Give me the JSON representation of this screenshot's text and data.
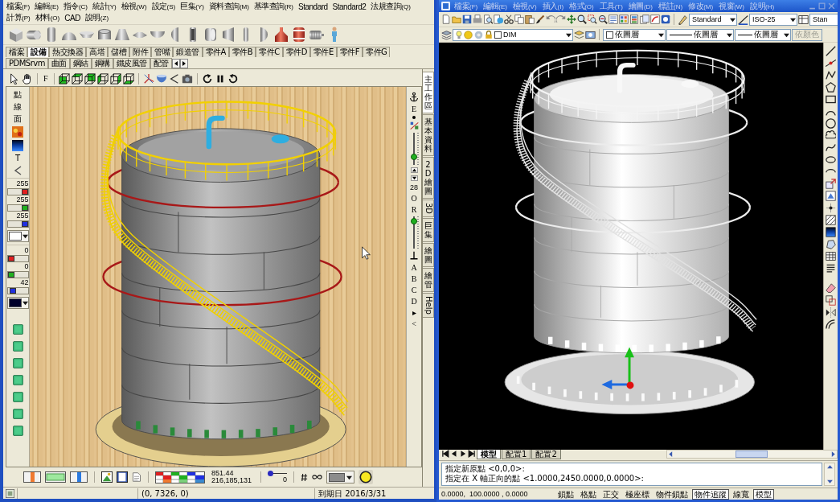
{
  "left_window": {
    "menu": [
      {
        "label": "檔案",
        "mnemonic": "(F)"
      },
      {
        "label": "編輯",
        "mnemonic": "(E)"
      },
      {
        "label": "指令",
        "mnemonic": "(C)"
      },
      {
        "label": "統計",
        "mnemonic": "(Y)"
      },
      {
        "label": "檢視",
        "mnemonic": "(W)"
      },
      {
        "label": "設定",
        "mnemonic": "(S)"
      },
      {
        "label": "巨集",
        "mnemonic": "(Y)"
      },
      {
        "label": "資料查詢",
        "mnemonic": "(M)"
      },
      {
        "label": "基準查詢",
        "mnemonic": "(R)"
      },
      {
        "label": "Standard"
      },
      {
        "label": "Standard2"
      },
      {
        "label": "法規查詢",
        "mnemonic": "(Q)"
      },
      {
        "label": "計算",
        "mnemonic": "(P)"
      },
      {
        "label": "材料",
        "mnemonic": "(O)"
      },
      {
        "label": "CAD"
      },
      {
        "label": "說明",
        "mnemonic": "(Z)"
      }
    ],
    "tabs": [
      {
        "label": "檔案",
        "selected": false
      },
      {
        "label": "設備",
        "selected": true
      },
      {
        "label": "熱交換器",
        "selected": false
      },
      {
        "label": "高塔",
        "selected": false
      },
      {
        "label": "儲槽",
        "selected": false
      },
      {
        "label": "附件",
        "selected": false
      },
      {
        "label": "管嘴",
        "selected": false
      },
      {
        "label": "鍛造管",
        "selected": false
      },
      {
        "label": "零件A",
        "selected": false
      },
      {
        "label": "零件B",
        "selected": false
      },
      {
        "label": "零件C",
        "selected": false
      },
      {
        "label": "零件D",
        "selected": false
      },
      {
        "label": "零件E",
        "selected": false
      },
      {
        "label": "零件F",
        "selected": false
      },
      {
        "label": "零件G",
        "selected": false
      },
      {
        "label": "PDMSrvm",
        "selected": false
      },
      {
        "label": "曲面",
        "selected": false
      },
      {
        "label": "鋼結",
        "selected": false
      },
      {
        "label": "鋼構",
        "selected": false
      },
      {
        "label": "鐵皮風管",
        "selected": false
      },
      {
        "label": "配管",
        "selected": false
      }
    ],
    "view_toolbar": {
      "frame_button": "F"
    },
    "side_panel": {
      "modes": [
        "點",
        "線",
        "面"
      ],
      "text_button": "T",
      "rgb_groups": [
        {
          "sliders": [
            {
              "value": "255",
              "level": 1,
              "color": "#e02020"
            },
            {
              "value": "255",
              "level": 1,
              "color": "#20b020"
            },
            {
              "value": "255",
              "level": 1,
              "color": "#2030e0"
            }
          ],
          "swatch": {
            "color": "#ffffff"
          }
        },
        {
          "sliders": [
            {
              "value": "0",
              "level": 0,
              "color": "#e02020"
            },
            {
              "value": "0",
              "level": 0,
              "color": "#20b020"
            },
            {
              "value": "42",
              "level": 0.16,
              "color": "#2030e0"
            }
          ],
          "swatch": {
            "color": "#00002a"
          }
        }
      ]
    },
    "tool_strip": {
      "letters_top": [
        "E"
      ],
      "slider_top": {
        "level": 0.2
      },
      "spinner": "28",
      "letters_mid": [
        "O",
        "R"
      ],
      "slider_bottom": {
        "level": 0.93
      },
      "letters_bottom": [
        "A",
        "B",
        "C",
        "D",
        "▸",
        "<"
      ]
    },
    "side_tabs": [
      {
        "label": "主工作區",
        "selected": true
      },
      {
        "label": "基本資料",
        "selected": false
      },
      {
        "label": "2D繪圖",
        "selected": false
      },
      {
        "label": "3D",
        "selected": false
      },
      {
        "label": "巨集",
        "selected": false
      },
      {
        "label": "繪圖",
        "selected": false
      },
      {
        "label": "繪管",
        "selected": false
      },
      {
        "label": "Help",
        "selected": false
      }
    ],
    "bottom_toolbar": {
      "readout": [
        "851.44",
        "216,185,131"
      ],
      "slider": {
        "value": "0",
        "level": 0
      },
      "swatch": {
        "color": "#8c8c8c"
      }
    },
    "status_bar": {
      "coordinates": "(0, 7326, 0)",
      "expiry": "到期日 2016/3/31"
    }
  },
  "right_window": {
    "menu": [
      {
        "label": "檔案",
        "mnemonic": "(F)"
      },
      {
        "label": "編輯",
        "mnemonic": "(E)"
      },
      {
        "label": "檢視",
        "mnemonic": "(V)"
      },
      {
        "label": "插入",
        "mnemonic": "(I)"
      },
      {
        "label": "格式",
        "mnemonic": "(O)"
      },
      {
        "label": "工具",
        "mnemonic": "(T)"
      },
      {
        "label": "繪圖",
        "mnemonic": "(D)"
      },
      {
        "label": "標註",
        "mnemonic": "(N)"
      },
      {
        "label": "修改",
        "mnemonic": "(M)"
      },
      {
        "label": "視窗",
        "mnemonic": "(W)"
      },
      {
        "label": "說明",
        "mnemonic": "(H)"
      }
    ],
    "styles": [
      {
        "kind": "text",
        "value": "Standard"
      },
      {
        "kind": "dimension",
        "value": "ISO-25"
      },
      {
        "kind": "table",
        "value": "Stan"
      }
    ],
    "layer": "DIM",
    "properties": [
      {
        "kind": "color",
        "value": "依圖層"
      },
      {
        "kind": "linetype",
        "value": "依圖層"
      },
      {
        "kind": "lineweight",
        "value": "依圖層"
      }
    ],
    "plot_style": {
      "value": "依顏色",
      "disabled": true
    },
    "layout_tabs": [
      {
        "label": "模型",
        "selected": true
      },
      {
        "label": "配置1",
        "selected": false
      },
      {
        "label": "配置2",
        "selected": false
      }
    ],
    "command_lines": [
      "指定新原點 <0,0,0>:",
      "指定在 X 軸正向的點 <1.0000,2450.0000,0.0000>:"
    ],
    "coordinates": "0.0000,  100.0000 , 0.0000",
    "status_toggles": [
      {
        "label": "鎖點",
        "on": false
      },
      {
        "label": "格點",
        "on": false
      },
      {
        "label": "正交",
        "on": false
      },
      {
        "label": "極座標",
        "on": false
      },
      {
        "label": "物件鎖點",
        "on": false
      },
      {
        "label": "物件追蹤",
        "on": true
      },
      {
        "label": "線寬",
        "on": false
      },
      {
        "label": "模型",
        "on": true
      }
    ]
  }
}
